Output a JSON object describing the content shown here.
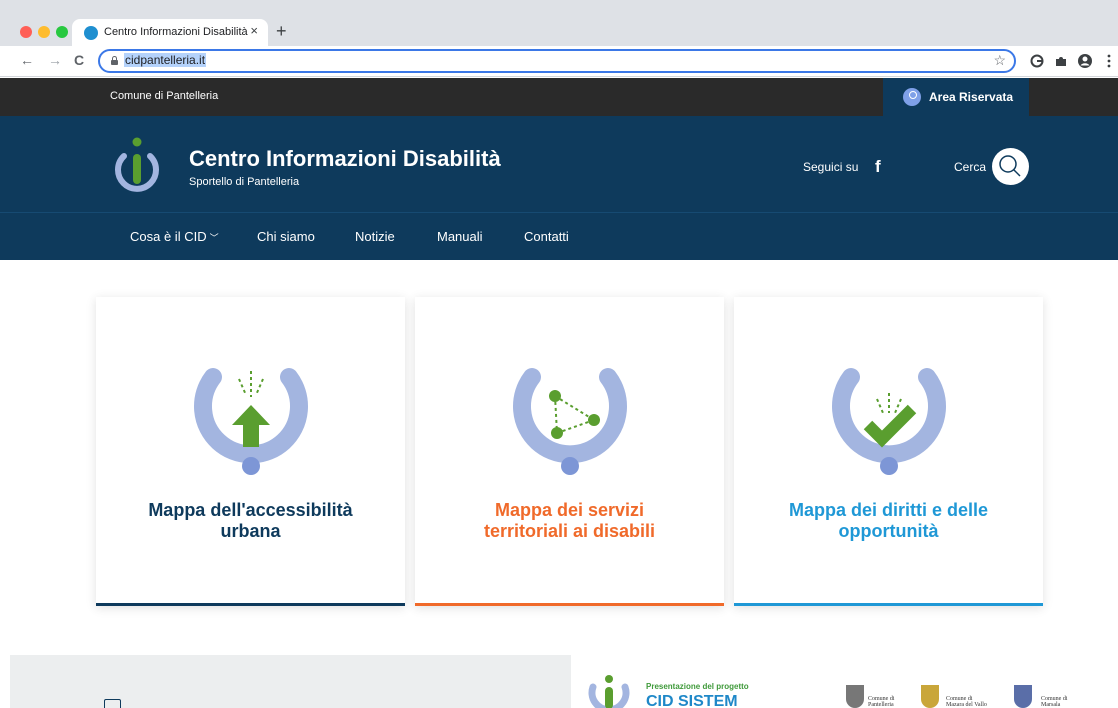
{
  "browser": {
    "tab_title": "Centro Informazioni Disabilità",
    "tab_close": "×",
    "new_tab": "+",
    "url": "cidpantelleria.it",
    "back": "←",
    "forward": "→",
    "reload": "C",
    "bookmark": "☆"
  },
  "topbar": {
    "comune": "Comune di Pantelleria",
    "area_riservata": "Area Riservata"
  },
  "header": {
    "title": "Centro Informazioni Disabilità",
    "subtitle": "Sportello di Pantelleria",
    "social_label": "Seguici su",
    "social_icon": "f",
    "search_label": "Cerca"
  },
  "nav": {
    "items": [
      {
        "label": "Cosa è il CID"
      },
      {
        "label": "Chi siamo"
      },
      {
        "label": "Notizie"
      },
      {
        "label": "Manuali"
      },
      {
        "label": "Contatti"
      }
    ]
  },
  "cards": [
    {
      "title_line1": "Mappa dell'accessibilità",
      "title_line2": "urbana",
      "color": "#0e3a5c",
      "icon": "arrow-up-icon"
    },
    {
      "title_line1": "Mappa dei servizi",
      "title_line2": "territoriali ai disabili",
      "color": "#f06a2a",
      "icon": "network-icon"
    },
    {
      "title_line1": "Mappa dei diritti e delle",
      "title_line2": "opportunità",
      "color": "#1f98d6",
      "icon": "checkmark-icon"
    }
  ],
  "promo": {
    "kicker": "Presentazione del progetto",
    "title": "CID SISTEM",
    "comuni": [
      {
        "line1": "Comune di",
        "line2": "Pantelleria"
      },
      {
        "line1": "Comune di",
        "line2": "Mazara del Vallo"
      },
      {
        "line1": "Comune di",
        "line2": "Marsala"
      }
    ]
  },
  "colors": {
    "header_bg": "#0e3a5c",
    "topbar_bg": "#2a2a2a",
    "ring": "#a3b5e0",
    "green": "#5a9e2f"
  }
}
